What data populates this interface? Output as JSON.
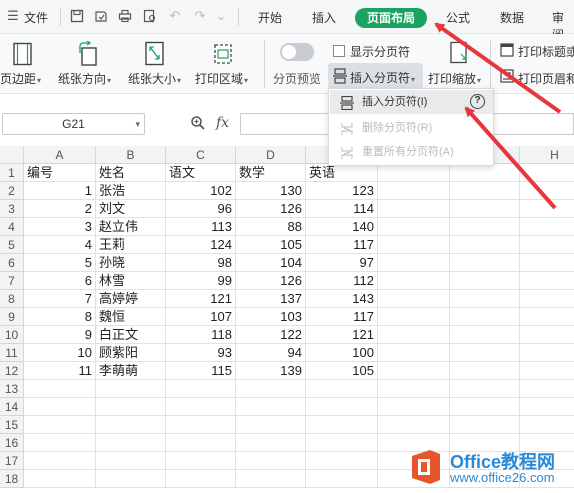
{
  "menubar": {
    "menu_icon_label": "文件",
    "tabs": [
      "开始",
      "插入",
      "页面布局",
      "公式",
      "数据",
      "审阅"
    ],
    "active_tab": "页面布局",
    "accent_color": "#1aa260"
  },
  "ribbon": {
    "margins": "页边距",
    "orientation": "纸张方向",
    "size": "纸张大小",
    "print_area": "打印区域",
    "page_break_preview": "分页预览",
    "show_page_breaks": "显示分页符",
    "insert_page_break": "插入分页符",
    "print_scaling": "打印缩放",
    "print_titles": "打印标题或",
    "print_header": "打印页眉和"
  },
  "dropdown": {
    "items": [
      {
        "label": "插入分页符(I)",
        "enabled": true
      },
      {
        "label": "删除分页符(R)",
        "enabled": false
      },
      {
        "label": "重置所有分页符(A)",
        "enabled": false
      }
    ],
    "help_icon": "?"
  },
  "formula_bar": {
    "cell_ref": "G21",
    "fx": "fx",
    "formula": ""
  },
  "sheet": {
    "columns": [
      "A",
      "B",
      "C",
      "D",
      "E",
      "F",
      "G",
      "H"
    ],
    "row_numbers": [
      "1",
      "2",
      "3",
      "4",
      "5",
      "6",
      "7",
      "8",
      "9",
      "10",
      "11",
      "12",
      "13",
      "14",
      "15",
      "16",
      "17",
      "18"
    ],
    "header": [
      "编号",
      "姓名",
      "语文",
      "数学",
      "英语"
    ],
    "rows": [
      [
        "1",
        "张浩",
        "102",
        "130",
        "123"
      ],
      [
        "2",
        "刘文",
        "96",
        "126",
        "114"
      ],
      [
        "3",
        "赵立伟",
        "113",
        "88",
        "140"
      ],
      [
        "4",
        "王莉",
        "124",
        "105",
        "117"
      ],
      [
        "5",
        "孙晓",
        "98",
        "104",
        "97"
      ],
      [
        "6",
        "林雪",
        "99",
        "126",
        "112"
      ],
      [
        "7",
        "高婷婷",
        "121",
        "137",
        "143"
      ],
      [
        "8",
        "魏恒",
        "107",
        "103",
        "117"
      ],
      [
        "9",
        "白正文",
        "118",
        "122",
        "121"
      ],
      [
        "10",
        "顾紫阳",
        "93",
        "94",
        "100"
      ],
      [
        "11",
        "李萌萌",
        "115",
        "139",
        "105"
      ]
    ]
  },
  "watermark": {
    "name": "Office教程网",
    "url": "www.office26.com"
  },
  "arrow_color": "#e8373c"
}
